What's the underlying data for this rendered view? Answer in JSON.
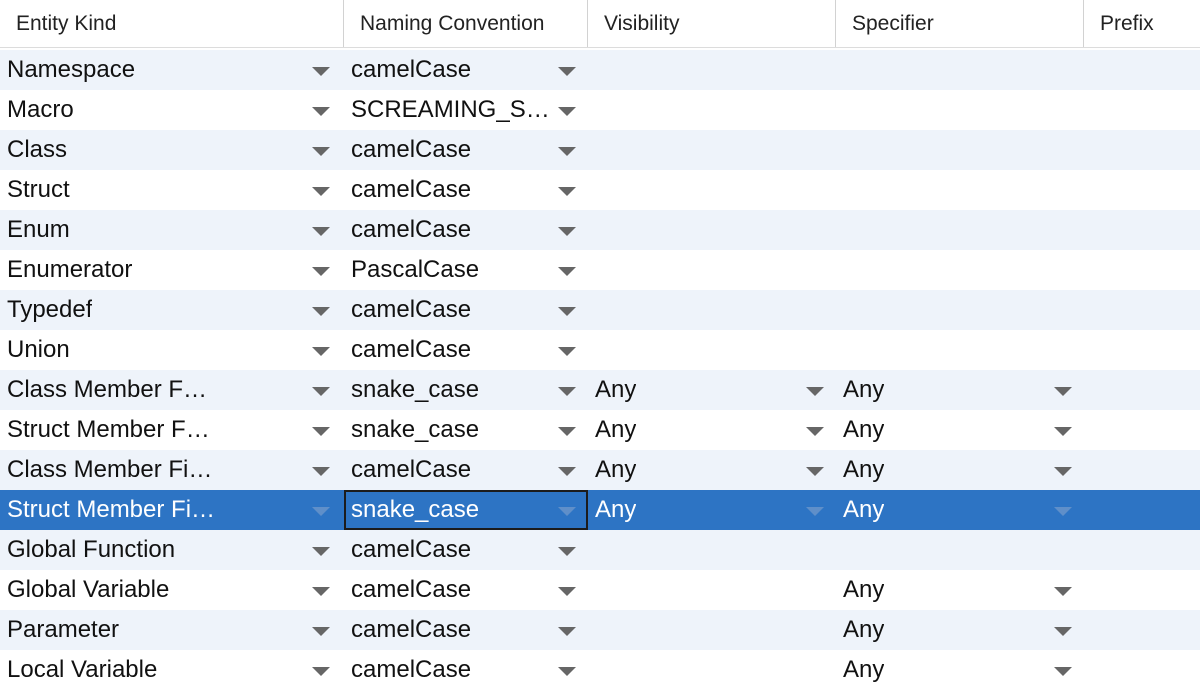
{
  "columns": [
    "Entity Kind",
    "Naming Convention",
    "Visibility",
    "Specifier",
    "Prefix"
  ],
  "colors": {
    "selected_row": "#2d74c4",
    "alt_row": "#eef3fa"
  },
  "icons": {
    "dropdown": "chevron-down-icon"
  },
  "rows": [
    {
      "kind": "Namespace",
      "convention": "camelCase",
      "visibility": "",
      "specifier": "",
      "prefix": ""
    },
    {
      "kind": "Macro",
      "convention": "SCREAMING_SN...",
      "visibility": "",
      "specifier": "",
      "prefix": ""
    },
    {
      "kind": "Class",
      "convention": "camelCase",
      "visibility": "",
      "specifier": "",
      "prefix": ""
    },
    {
      "kind": "Struct",
      "convention": "camelCase",
      "visibility": "",
      "specifier": "",
      "prefix": ""
    },
    {
      "kind": "Enum",
      "convention": "camelCase",
      "visibility": "",
      "specifier": "",
      "prefix": ""
    },
    {
      "kind": "Enumerator",
      "convention": "PascalCase",
      "visibility": "",
      "specifier": "",
      "prefix": ""
    },
    {
      "kind": "Typedef",
      "convention": "camelCase",
      "visibility": "",
      "specifier": "",
      "prefix": ""
    },
    {
      "kind": "Union",
      "convention": "camelCase",
      "visibility": "",
      "specifier": "",
      "prefix": ""
    },
    {
      "kind": "Class Member Function",
      "convention": "snake_case",
      "visibility": "Any",
      "specifier": "Any",
      "prefix": ""
    },
    {
      "kind": "Struct Member Function",
      "convention": "snake_case",
      "visibility": "Any",
      "specifier": "Any",
      "prefix": ""
    },
    {
      "kind": "Class Member Field",
      "convention": "camelCase",
      "visibility": "Any",
      "specifier": "Any",
      "prefix": ""
    },
    {
      "kind": "Struct Member Field",
      "convention": "snake_case",
      "visibility": "Any",
      "specifier": "Any",
      "prefix": "",
      "selected": true
    },
    {
      "kind": "Global Function",
      "convention": "camelCase",
      "visibility": "",
      "specifier": "",
      "prefix": ""
    },
    {
      "kind": "Global Variable",
      "convention": "camelCase",
      "visibility": "",
      "specifier": "Any",
      "prefix": ""
    },
    {
      "kind": "Parameter",
      "convention": "camelCase",
      "visibility": "",
      "specifier": "Any",
      "prefix": ""
    },
    {
      "kind": "Local Variable",
      "convention": "camelCase",
      "visibility": "",
      "specifier": "Any",
      "prefix": ""
    }
  ]
}
